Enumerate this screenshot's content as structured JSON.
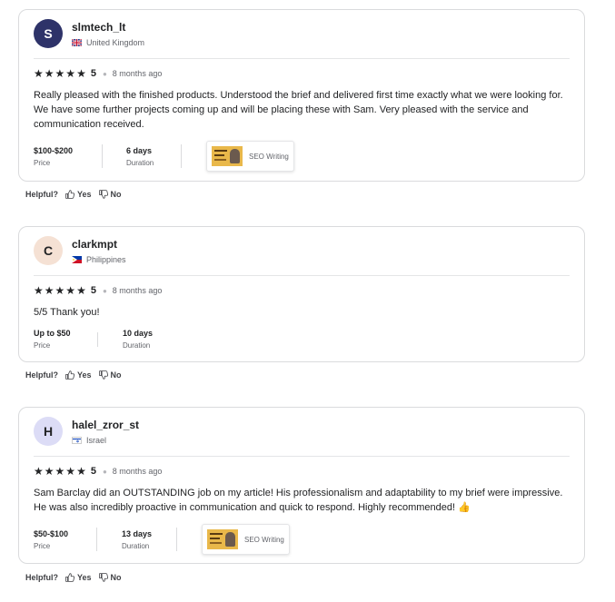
{
  "reviews": [
    {
      "avatar_letter": "S",
      "avatar_bg": "#2e3369",
      "avatar_fg": "#ffffff",
      "username": "slmtech_lt",
      "country": "United Kingdom",
      "flag": "uk-flag-icon",
      "rating": 5,
      "score": "5",
      "time": "8 months ago",
      "text": "Really pleased with the finished products. Understood the brief and delivered first time exactly what we were looking for. We have some further projects coming up and will be placing these with Sam. Very pleased with the service and communication received.",
      "price": "$100-$200",
      "price_label": "Price",
      "duration": "6 days",
      "duration_label": "Duration",
      "gig_label": "SEO Writing"
    },
    {
      "avatar_letter": "C",
      "avatar_bg": "#f5e1d4",
      "avatar_fg": "#222325",
      "username": "clarkmpt",
      "country": "Philippines",
      "flag": "philippines-flag-icon",
      "rating": 5,
      "score": "5",
      "time": "8 months ago",
      "text": "5/5 Thank you!",
      "price": "Up to $50",
      "price_label": "Price",
      "duration": "10 days",
      "duration_label": "Duration",
      "gig_label": ""
    },
    {
      "avatar_letter": "H",
      "avatar_bg": "#dcdcf6",
      "avatar_fg": "#222325",
      "username": "halel_zror_st",
      "country": "Israel",
      "flag": "israel-flag-icon",
      "rating": 5,
      "score": "5",
      "time": "8 months ago",
      "text": "Sam Barclay did an OUTSTANDING job on my article! His professionalism and adaptability to my brief were impressive. He was also incredibly proactive in communication and quick to respond. Highly recommended! 👍",
      "price": "$50-$100",
      "price_label": "Price",
      "duration": "13 days",
      "duration_label": "Duration",
      "gig_label": "SEO Writing"
    }
  ],
  "helpful": {
    "label": "Helpful?",
    "yes": "Yes",
    "no": "No"
  }
}
